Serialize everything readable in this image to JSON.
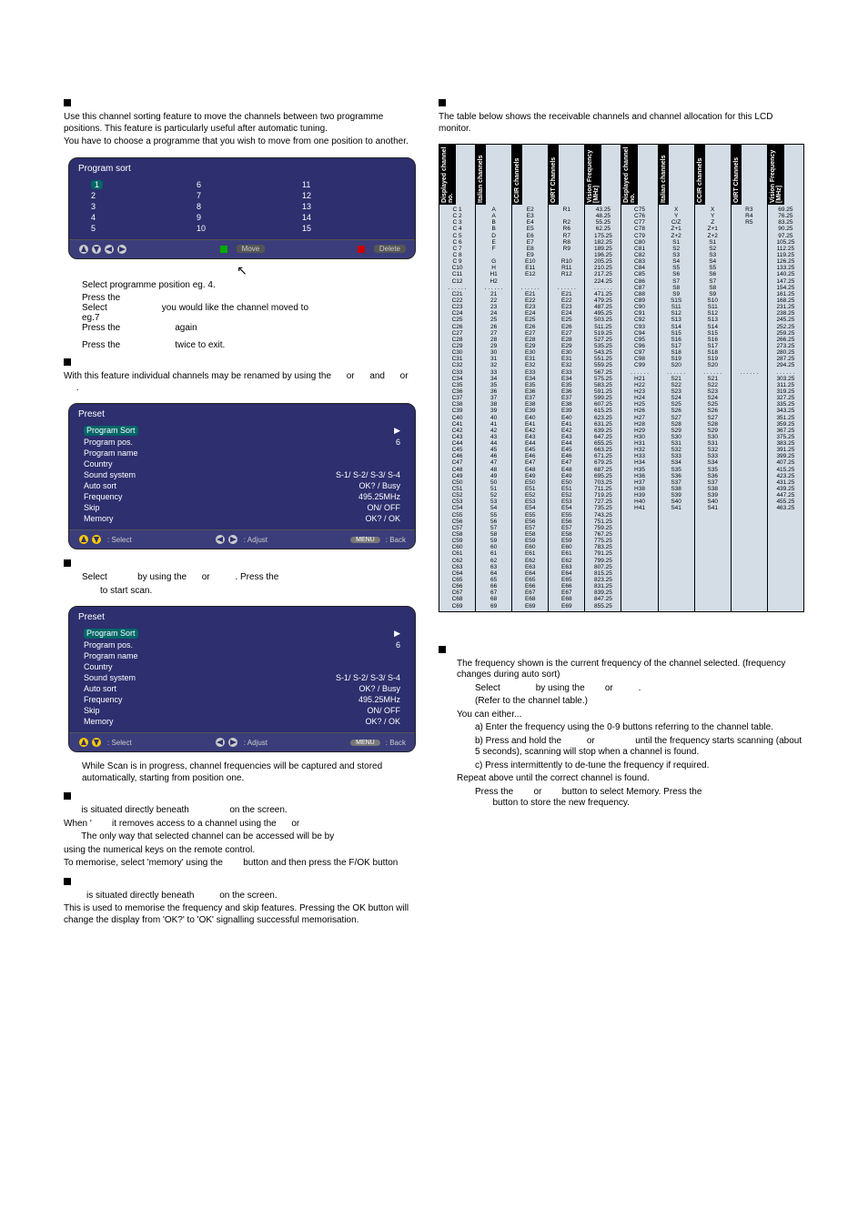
{
  "left": {
    "sort_head": "",
    "sort_p1": "Use this channel sorting feature to move the channels between two programme positions. This feature is particularly useful after automatic tuning.",
    "sort_p2": "You have to choose a programme that you wish to move from one position to another.",
    "osd_sort": {
      "title": "Program sort",
      "cols": [
        [
          "1",
          "2",
          "3",
          "4",
          "5"
        ],
        [
          "6",
          "7",
          "8",
          "9",
          "10"
        ],
        [
          "11",
          "12",
          "13",
          "14",
          "15"
        ]
      ],
      "foot_move": "Move",
      "foot_delete": "Delete"
    },
    "sort_step1": "Select programme position eg. 4.",
    "sort_step2a": "Press the",
    "sort_step2b": "Select",
    "sort_step2c": "you would like the channel moved to",
    "sort_step2d": "eg.7",
    "sort_step3a": "Press the",
    "sort_step3b": "again",
    "sort_step4a": "Press the",
    "sort_step4b": "twice to exit.",
    "name_head": "",
    "name_p1_a": "With this feature individual channels may be renamed by using the",
    "name_p1_b": "or",
    "name_p1_c": "and",
    "name_p1_d": "or",
    "name_p1_e": ".",
    "osd_preset": {
      "title": "Preset",
      "rows": [
        [
          "Program Sort",
          "▶"
        ],
        [
          "Program pos.",
          "6"
        ],
        [
          "Program name",
          ""
        ],
        [
          "Country",
          ""
        ],
        [
          "Sound system",
          "S-1/ S-2/ S-3/ S-4"
        ],
        [
          "Auto sort",
          "OK? / Busy"
        ],
        [
          "Frequency",
          "495.25MHz"
        ],
        [
          "Skip",
          "ON/ OFF"
        ],
        [
          "Memory",
          "OK? / OK"
        ]
      ],
      "foot_select": ": Select",
      "foot_adjust": ": Adjust",
      "foot_back": ": Back",
      "foot_menu": "MENU"
    },
    "auto_head": "",
    "auto_p1a": "Select",
    "auto_p1b": "by using the",
    "auto_p1c": "or",
    "auto_p1d": ". Press the",
    "auto_p2": "to start scan.",
    "auto_p3": "While Scan is in progress, channel frequencies will be captured and stored automatically, starting from position one.",
    "skip_p1": "is situated directly beneath",
    "skip_p1b": "on the screen.",
    "skip_p2a": "When '",
    "skip_p2b": "it removes access to a channel using the",
    "skip_p2c": "or",
    "skip_p3": "The only way that selected channel can be accessed will be by",
    "skip_p4": "using the numerical keys on the remote control.",
    "skip_p5a": "To memorise, select 'memory' using the",
    "skip_p5b": "button and then press the F/OK button",
    "mem_p1a": "is situated directly beneath",
    "mem_p1b": "on the screen.",
    "mem_p2": "This is used to memorise the frequency and skip features. Pressing the OK button will change the display from 'OK?' to 'OK' signalling successful memorisation."
  },
  "right": {
    "chtab_head": "",
    "chtab_intro": "The table below shows the receivable channels and channel allocation for this LCD monitor.",
    "headers": [
      "Displayed\nchannel no.",
      "Italian\nchannels",
      "CCIR\nchannels",
      "OIRT\nChannels",
      "Vision\nFrequency\n[MHz]",
      "Displayed\nchannel no.",
      "Italian\nchannels",
      "CCIR\nchannels",
      "OIRT\nChannels",
      "Vision\nFrequency\n[MHz]"
    ],
    "chart_data": {
      "type": "table",
      "columns": [
        "Displayed channel no.",
        "Italian channels",
        "CCIR channels",
        "OIRT Channels",
        "Vision Frequency [MHz]"
      ],
      "groups": [
        {
          "rows": [
            [
              "C 1",
              "A",
              "E2",
              "R1",
              "43.25"
            ],
            [
              "C 2",
              "A",
              "E3",
              "",
              "48.25"
            ],
            [
              "C 3",
              "B",
              "E4",
              "R2",
              "55.25"
            ],
            [
              "C 4",
              "B",
              "E5",
              "R6",
              "62.25"
            ],
            [
              "C 5",
              "D",
              "E6",
              "R7",
              "175.25"
            ],
            [
              "C 6",
              "E",
              "E7",
              "R8",
              "182.25"
            ],
            [
              "C 7",
              "F",
              "E8",
              "R9",
              "189.25"
            ],
            [
              "C 8",
              "",
              "E9",
              "",
              "196.25"
            ],
            [
              "C 9",
              "G",
              "E10",
              "R10",
              "205.25"
            ],
            [
              "C10",
              "H",
              "E11",
              "R11",
              "210.25"
            ],
            [
              "C11",
              "H1",
              "E12",
              "R12",
              "217.25"
            ],
            [
              "C12",
              "H2",
              "",
              "",
              "224.25"
            ]
          ]
        },
        {
          "rows": [
            [
              "C21",
              "21",
              "E21",
              "E21",
              "471.25"
            ],
            [
              "C22",
              "22",
              "E22",
              "E22",
              "479.25"
            ],
            [
              "C23",
              "23",
              "E23",
              "E23",
              "487.25"
            ],
            [
              "C24",
              "24",
              "E24",
              "E24",
              "495.25"
            ],
            [
              "C25",
              "25",
              "E25",
              "E25",
              "503.25"
            ],
            [
              "C26",
              "26",
              "E26",
              "E26",
              "511.25"
            ],
            [
              "C27",
              "27",
              "E27",
              "E27",
              "519.25"
            ],
            [
              "C28",
              "28",
              "E28",
              "E28",
              "527.25"
            ],
            [
              "C29",
              "29",
              "E29",
              "E29",
              "535.25"
            ],
            [
              "C30",
              "30",
              "E30",
              "E30",
              "543.25"
            ],
            [
              "C31",
              "31",
              "E31",
              "E31",
              "551.25"
            ],
            [
              "C32",
              "32",
              "E32",
              "E32",
              "559.25"
            ],
            [
              "C33",
              "33",
              "E33",
              "E33",
              "567.25"
            ],
            [
              "C34",
              "34",
              "E34",
              "E34",
              "575.25"
            ],
            [
              "C35",
              "35",
              "E35",
              "E35",
              "583.25"
            ],
            [
              "C36",
              "36",
              "E36",
              "E36",
              "591.25"
            ],
            [
              "C37",
              "37",
              "E37",
              "E37",
              "599.25"
            ],
            [
              "C38",
              "38",
              "E38",
              "E38",
              "607.25"
            ],
            [
              "C39",
              "39",
              "E39",
              "E39",
              "615.25"
            ],
            [
              "C40",
              "40",
              "E40",
              "E40",
              "623.25"
            ],
            [
              "C41",
              "41",
              "E41",
              "E41",
              "631.25"
            ],
            [
              "C42",
              "42",
              "E42",
              "E42",
              "639.25"
            ],
            [
              "C43",
              "43",
              "E43",
              "E43",
              "647.25"
            ],
            [
              "C44",
              "44",
              "E44",
              "E44",
              "655.25"
            ],
            [
              "C45",
              "45",
              "E45",
              "E45",
              "663.25"
            ],
            [
              "C46",
              "46",
              "E46",
              "E46",
              "671.25"
            ],
            [
              "C47",
              "47",
              "E47",
              "E47",
              "679.25"
            ],
            [
              "C48",
              "48",
              "E48",
              "E48",
              "687.25"
            ],
            [
              "C49",
              "49",
              "E49",
              "E49",
              "695.25"
            ],
            [
              "C50",
              "50",
              "E50",
              "E50",
              "703.25"
            ],
            [
              "C51",
              "51",
              "E51",
              "E51",
              "711.25"
            ],
            [
              "C52",
              "52",
              "E52",
              "E52",
              "719.25"
            ],
            [
              "C53",
              "53",
              "E53",
              "E53",
              "727.25"
            ],
            [
              "C54",
              "54",
              "E54",
              "E54",
              "735.25"
            ],
            [
              "C55",
              "55",
              "E55",
              "E55",
              "743.25"
            ],
            [
              "C56",
              "56",
              "E56",
              "E56",
              "751.25"
            ],
            [
              "C57",
              "57",
              "E57",
              "E57",
              "759.25"
            ],
            [
              "C58",
              "58",
              "E58",
              "E58",
              "767.25"
            ],
            [
              "C59",
              "59",
              "E59",
              "E59",
              "775.25"
            ],
            [
              "C60",
              "60",
              "E60",
              "E60",
              "783.25"
            ],
            [
              "C61",
              "61",
              "E61",
              "E61",
              "791.25"
            ],
            [
              "C62",
              "62",
              "E62",
              "E62",
              "799.25"
            ],
            [
              "C63",
              "63",
              "E63",
              "E63",
              "807.25"
            ],
            [
              "C64",
              "64",
              "E64",
              "E64",
              "815.25"
            ],
            [
              "C65",
              "65",
              "E65",
              "E65",
              "823.25"
            ],
            [
              "C66",
              "66",
              "E66",
              "E66",
              "831.25"
            ],
            [
              "C67",
              "67",
              "E67",
              "E67",
              "839.25"
            ],
            [
              "C68",
              "68",
              "E68",
              "E68",
              "847.25"
            ],
            [
              "C69",
              "69",
              "E69",
              "E69",
              "855.25"
            ]
          ]
        },
        {
          "rows": [
            [
              "C75",
              "X",
              "X",
              "R3",
              "69.25"
            ],
            [
              "C76",
              "Y",
              "Y",
              "R4",
              "76.25"
            ],
            [
              "C77",
              "C/Z",
              "Z",
              "R5",
              "83.25"
            ],
            [
              "C78",
              "Z+1",
              "Z+1",
              "",
              "90.25"
            ],
            [
              "C79",
              "Z+2",
              "Z+2",
              "",
              "97.25"
            ],
            [
              "C80",
              "S1",
              "S1",
              "",
              "105.25"
            ],
            [
              "C81",
              "S2",
              "S2",
              "",
              "112.25"
            ],
            [
              "C82",
              "S3",
              "S3",
              "",
              "119.25"
            ],
            [
              "C83",
              "S4",
              "S4",
              "",
              "126.25"
            ],
            [
              "C84",
              "S5",
              "S5",
              "",
              "133.25"
            ],
            [
              "C85",
              "S6",
              "S6",
              "",
              "140.25"
            ],
            [
              "C86",
              "S7",
              "S7",
              "",
              "147.25"
            ],
            [
              "C87",
              "S8",
              "S8",
              "",
              "154.25"
            ],
            [
              "C88",
              "S9",
              "S9",
              "",
              "161.25"
            ],
            [
              "C89",
              "S1S",
              "S10",
              "",
              "168.25"
            ],
            [
              "C90",
              "S11",
              "S11",
              "",
              "231.25"
            ],
            [
              "C91",
              "S12",
              "S12",
              "",
              "238.25"
            ],
            [
              "C92",
              "S13",
              "S13",
              "",
              "245.25"
            ],
            [
              "C93",
              "S14",
              "S14",
              "",
              "252.25"
            ],
            [
              "C94",
              "S15",
              "S15",
              "",
              "259.25"
            ],
            [
              "C95",
              "S16",
              "S16",
              "",
              "266.25"
            ],
            [
              "C96",
              "S17",
              "S17",
              "",
              "273.25"
            ],
            [
              "C97",
              "S18",
              "S18",
              "",
              "280.25"
            ],
            [
              "C98",
              "S19",
              "S19",
              "",
              "287.25"
            ],
            [
              "C99",
              "S20",
              "S20",
              "",
              "294.25"
            ]
          ]
        },
        {
          "rows": [
            [
              "H21",
              "S21",
              "S21",
              "",
              "303.25"
            ],
            [
              "H22",
              "S22",
              "S22",
              "",
              "311.25"
            ],
            [
              "H23",
              "S23",
              "S23",
              "",
              "319.25"
            ],
            [
              "H24",
              "S24",
              "S24",
              "",
              "327.25"
            ],
            [
              "H25",
              "S25",
              "S25",
              "",
              "335.25"
            ],
            [
              "H26",
              "S26",
              "S26",
              "",
              "343.25"
            ],
            [
              "H27",
              "S27",
              "S27",
              "",
              "351.25"
            ],
            [
              "H28",
              "S28",
              "S28",
              "",
              "359.25"
            ],
            [
              "H29",
              "S29",
              "S29",
              "",
              "367.25"
            ],
            [
              "H30",
              "S30",
              "S30",
              "",
              "375.25"
            ],
            [
              "H31",
              "S31",
              "S31",
              "",
              "383.25"
            ],
            [
              "H32",
              "S32",
              "S32",
              "",
              "391.25"
            ],
            [
              "H33",
              "S33",
              "S33",
              "",
              "399.25"
            ],
            [
              "H34",
              "S34",
              "S34",
              "",
              "407.25"
            ],
            [
              "H35",
              "S35",
              "S35",
              "",
              "415.25"
            ],
            [
              "H36",
              "S36",
              "S36",
              "",
              "423.25"
            ],
            [
              "H37",
              "S37",
              "S37",
              "",
              "431.25"
            ],
            [
              "H38",
              "S38",
              "S38",
              "",
              "439.25"
            ],
            [
              "H39",
              "S39",
              "S39",
              "",
              "447.25"
            ],
            [
              "H40",
              "S40",
              "S40",
              "",
              "455.25"
            ],
            [
              "H41",
              "S41",
              "S41",
              "",
              "463.25"
            ]
          ]
        }
      ]
    },
    "freq_head": "",
    "freq_p1": "The frequency shown is the current frequency of the channel selected. (frequency changes during auto sort)",
    "freq_sel_a": "Select",
    "freq_sel_b": "by using the",
    "freq_sel_c": "or",
    "freq_sel_d": ".",
    "freq_sel_e": "(Refer to the channel table.)",
    "freq_can": "You can either...",
    "freq_a": "a) Enter the frequency using the 0-9 buttons referring to the channel table.",
    "freq_b1": "b) Press and hold the",
    "freq_b2": "or",
    "freq_b3": "until the frequency starts scanning (about 5 seconds), scanning will stop when a channel is found.",
    "freq_c": "c) Press intermittently to de-tune the frequency if required.",
    "freq_rep": "Repeat above until the correct channel is found.",
    "freq_mem1": "Press the",
    "freq_mem2": "or",
    "freq_mem3": "button to select Memory. Press the",
    "freq_mem4": "button to store the new frequency."
  }
}
